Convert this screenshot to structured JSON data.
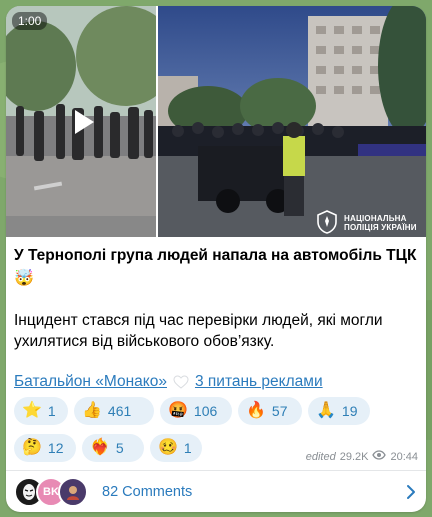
{
  "post": {
    "video_duration": "1:00",
    "title": "У Тернополі група людей напала на автомобіль ТЦК",
    "title_emoji": "🤯",
    "body": "Інцидент стався під час перевірки людей, які могли ухилятися від військового обов’язку.",
    "link_1": "Батальйон «Монако»",
    "link_2": "3 питань реклами",
    "watermark": "НАЦІОНАЛЬНА ПОЛІЦІЯ УКРАЇНИ"
  },
  "reactions": [
    {
      "emoji": "⭐",
      "count": "1"
    },
    {
      "emoji": "👍",
      "count": "461"
    },
    {
      "emoji": "🤬",
      "count": "106"
    },
    {
      "emoji": "🔥",
      "count": "57"
    },
    {
      "emoji": "🙏",
      "count": "19"
    },
    {
      "emoji": "🤔",
      "count": "12"
    },
    {
      "emoji": "❤️‍🔥",
      "count": "5"
    },
    {
      "emoji": "🥴",
      "count": "1"
    }
  ],
  "meta": {
    "edited": "edited",
    "views": "29.2K",
    "time": "20:44"
  },
  "comments": {
    "label": "82 Comments",
    "avatar_2_initials": "BK"
  },
  "colors": {
    "link": "#2b7bbd",
    "pill_bg": "#e6f0f8",
    "background": "#7fa86b"
  },
  "icons": [
    "play-icon",
    "heart-icon",
    "eye-icon",
    "chevron-right-icon",
    "police-emblem-icon"
  ]
}
